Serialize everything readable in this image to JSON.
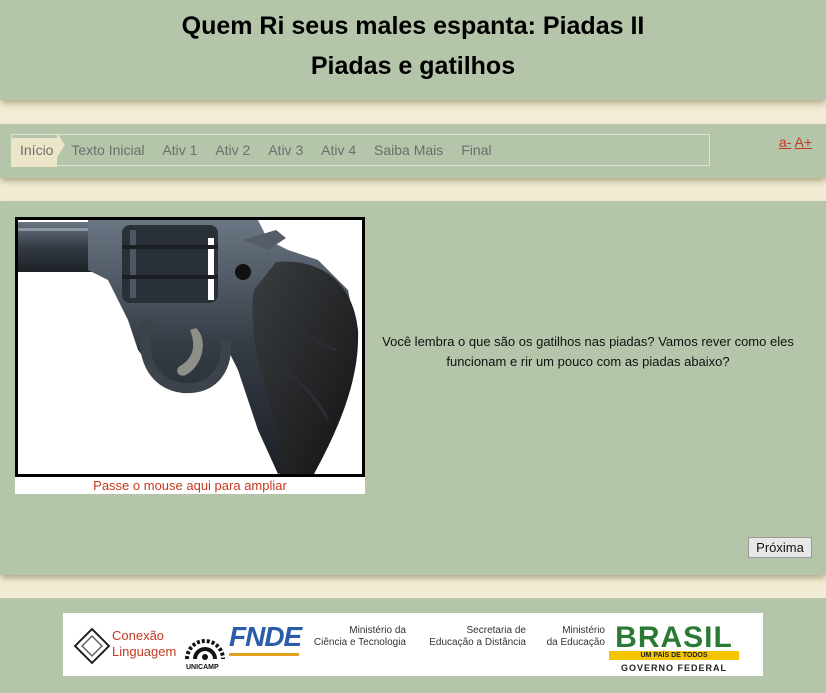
{
  "header": {
    "title": "Quem Ri seus males espanta: Piadas II",
    "subtitle": "Piadas e gatilhos"
  },
  "nav": {
    "items": [
      "Início",
      "Texto Inicial",
      "Ativ 1",
      "Ativ 2",
      "Ativ 3",
      "Ativ 4",
      "Saiba Mais",
      "Final"
    ],
    "active_index": 0,
    "font_decrease": "a-",
    "font_increase": "A+"
  },
  "main": {
    "image_icon": "revolver-image",
    "image_caption": "Passe o mouse aqui para ampliar",
    "intro_text": "Você lembra o que são os gatilhos nas piadas? Vamos rever como eles funcionam e rir um pouco com as piadas abaixo?",
    "next_label": "Próxima"
  },
  "footer": {
    "conexao": [
      "Conexão",
      "Linguagem"
    ],
    "unicamp": "UNICAMP",
    "fnde": "FNDE",
    "mct": [
      "Ministério da",
      "Ciência e Tecnologia"
    ],
    "sead": [
      "Secretaria de",
      "Educação a Distância"
    ],
    "mec": [
      "Ministério",
      "da Educação"
    ],
    "brasil": "BRASIL",
    "brasil_tagline": "UM PAÍS DE TODOS",
    "governo": "GOVERNO FEDERAL"
  },
  "colors": {
    "panel": "#b5c5a9",
    "background": "#f1ecd3",
    "accent_red": "#c4391f"
  }
}
